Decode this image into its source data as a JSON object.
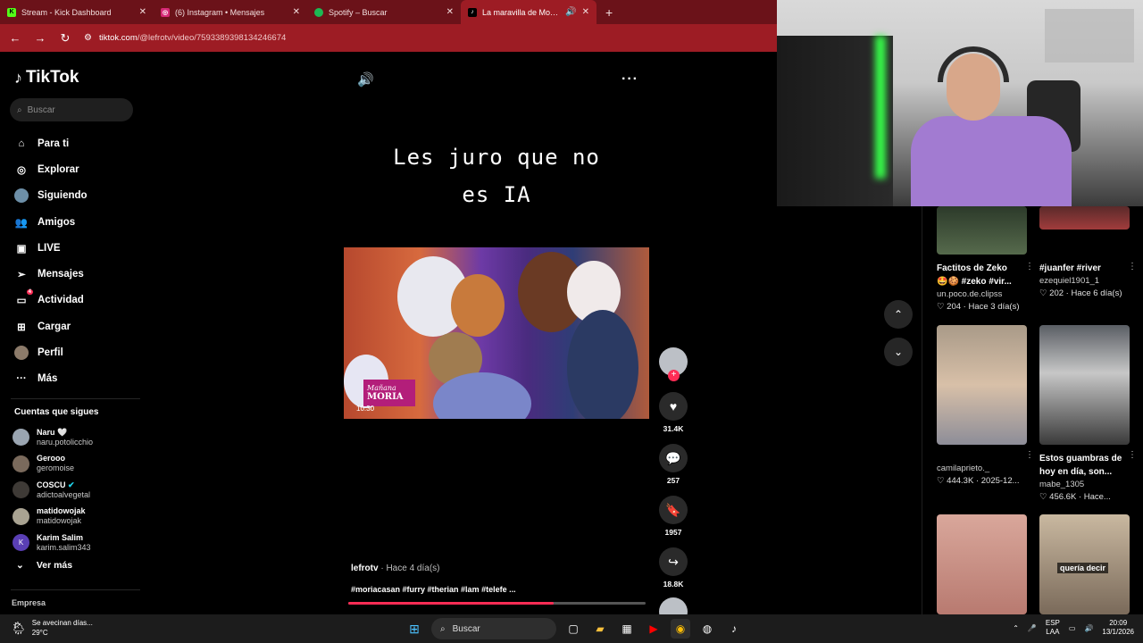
{
  "browser": {
    "tabs": [
      {
        "title": "Stream - Kick Dashboard",
        "fav": "K",
        "fav_color": "#53fc18"
      },
      {
        "title": "(6) Instagram • Mensajes",
        "fav": "◎",
        "fav_color": "#d62976"
      },
      {
        "title": "Spotify – Buscar",
        "fav": "●",
        "fav_color": "#1db954"
      },
      {
        "title": "La maravilla de Moria Casan",
        "fav": "♪",
        "fav_color": "#000000"
      }
    ],
    "url_host": "tiktok.com",
    "url_path": "/@lefrotv/video/7593389398134246674"
  },
  "sidebar": {
    "logo": "TikTok",
    "search_placeholder": "Buscar",
    "menu": [
      {
        "label": "Para ti",
        "icon": "home-icon"
      },
      {
        "label": "Explorar",
        "icon": "compass-icon"
      },
      {
        "label": "Siguiendo",
        "icon": "following-avatar-icon"
      },
      {
        "label": "Amigos",
        "icon": "friends-icon"
      },
      {
        "label": "LIVE",
        "icon": "live-icon"
      },
      {
        "label": "Mensajes",
        "icon": "send-icon"
      },
      {
        "label": "Actividad",
        "icon": "inbox-icon",
        "badge": "4"
      },
      {
        "label": "Cargar",
        "icon": "plus-square-icon"
      },
      {
        "label": "Perfil",
        "icon": "profile-icon"
      },
      {
        "label": "Más",
        "icon": "ellipsis-icon"
      }
    ],
    "following_title": "Cuentas que sigues",
    "following": [
      {
        "name": "Naru 🤍",
        "user": "naru.potolicchio"
      },
      {
        "name": "Gerooo",
        "user": "geromoise"
      },
      {
        "name": "COSCU",
        "user": "adictoalvegetal",
        "verified": true
      },
      {
        "name": "matidowojak",
        "user": "matidowojak"
      },
      {
        "name": "Karim Salim",
        "user": "karim.salim343",
        "initial": "K"
      }
    ],
    "see_more": "Ver más",
    "company": "Empresa"
  },
  "video": {
    "overlay_text_line1": "Les juro que no",
    "overlay_text_line2": "es IA",
    "clip_logo_line1": "Mañana",
    "clip_logo_line2": "MORIA",
    "clip_time": "10:30",
    "author": "lefrotv",
    "posted": " · Hace 4 día(s)",
    "hashtags": "#moriacasan #furry #therian #lam #telefe ...",
    "progress": 0.69,
    "likes": "31.4K",
    "comments": "257",
    "saves": "1957",
    "shares": "18.8K"
  },
  "feed": [
    {
      "title": "Factitos de Zeko",
      "title2": "🤩🍪 #zeko #vir...",
      "user": "un.poco.de.clipss",
      "likes": "204",
      "when": "Hace 3 día(s)"
    },
    {
      "title": "#juanfer #river",
      "user": "ezequiel1901_1",
      "likes": "202",
      "when": "Hace 6 día(s)"
    },
    {
      "title": "",
      "user": "camilaprieto._",
      "likes": "444.3K",
      "when": "2025-12..."
    },
    {
      "title": "Estos guambras de",
      "title2": "hoy en día, son...",
      "user": "mabe_1305",
      "likes": "456.6K",
      "when": "Hace..."
    },
    {
      "title": "",
      "user": "",
      "likes": "",
      "when": "",
      "overlay": "quería decir"
    }
  ],
  "taskbar": {
    "weather_text": "Se avecinan días...",
    "temperature": "29°C",
    "search_label": "Buscar",
    "lang1": "ESP",
    "lang2": "LAA",
    "time": "20:09",
    "date": "13/1/2026"
  }
}
